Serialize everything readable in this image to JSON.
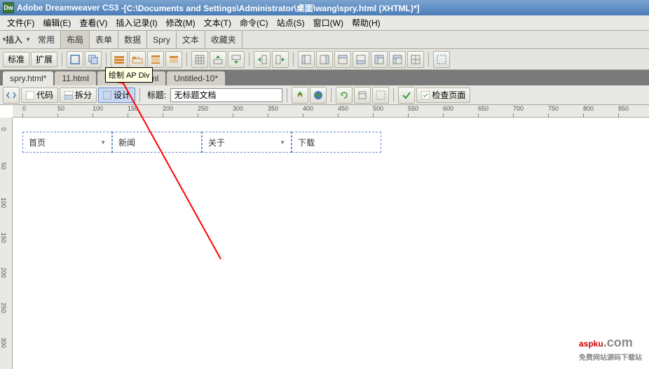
{
  "title_prefix": "Adobe Dreamweaver CS3 - ",
  "title_path": "[C:\\Documents and Settings\\Administrator\\桌面\\wang\\spry.html (XHTML)*]",
  "app_badge": "Dw",
  "menubar": [
    "文件(F)",
    "编辑(E)",
    "查看(V)",
    "插入记录(I)",
    "修改(M)",
    "文本(T)",
    "命令(C)",
    "站点(S)",
    "窗口(W)",
    "帮助(H)"
  ],
  "insert_label": "插入",
  "insert_tabs": [
    "常用",
    "布局",
    "表单",
    "数据",
    "Spry",
    "文本",
    "收藏夹"
  ],
  "insert_active": "布局",
  "layout_btns": {
    "standard": "标准",
    "expanded": "扩展"
  },
  "tooltip_text": "绘制 AP Div",
  "file_tabs": [
    {
      "label": "spry.html*",
      "active": true
    },
    {
      "label": "11.html",
      "active": false
    },
    {
      "label": "Untitled-9.html",
      "active": false
    },
    {
      "label": "Untitled-10*",
      "active": false
    }
  ],
  "doc_toolbar": {
    "code": "代码",
    "split": "拆分",
    "design": "设计",
    "title_label": "标题:",
    "title_value": "无标题文档",
    "check_page": "检查页面"
  },
  "ruler_h": [
    "0",
    "50",
    "100",
    "150",
    "200",
    "250",
    "300",
    "350",
    "400",
    "450",
    "500",
    "550",
    "600",
    "650",
    "700",
    "750",
    "800",
    "850"
  ],
  "ruler_v": [
    "0",
    "50",
    "100",
    "150",
    "200",
    "250",
    "300"
  ],
  "nav_items": [
    {
      "label": "首页",
      "arrow": true
    },
    {
      "label": "新闻",
      "arrow": false
    },
    {
      "label": "关于",
      "arrow": true
    },
    {
      "label": "下载",
      "arrow": false
    }
  ],
  "watermark": {
    "main": "aspku",
    "suffix": ".com",
    "sub": "免费网站源码下载站"
  }
}
